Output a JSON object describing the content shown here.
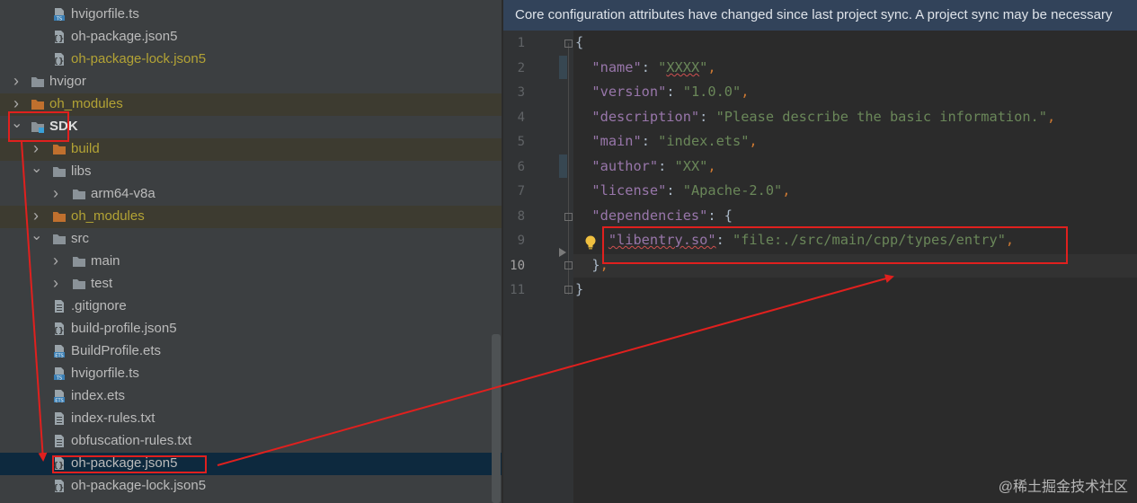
{
  "project_tree": {
    "rows": [
      {
        "label": "hvigorfile.ts",
        "icon": "ts-file-icon",
        "indent": 1,
        "arrow": "",
        "style": ""
      },
      {
        "label": "oh-package.json5",
        "icon": "json5-file-icon",
        "indent": 1,
        "arrow": "",
        "style": ""
      },
      {
        "label": "oh-package-lock.json5",
        "icon": "json5-file-icon",
        "indent": 1,
        "arrow": "",
        "style": "modified"
      },
      {
        "label": "hvigor",
        "icon": "folder-icon",
        "indent": 0,
        "arrow": "right",
        "style": ""
      },
      {
        "label": "oh_modules",
        "icon": "folder-excluded-icon",
        "indent": 0,
        "arrow": "right",
        "style": "excluded"
      },
      {
        "label": "SDK",
        "icon": "module-folder-icon",
        "indent": 0,
        "arrow": "down",
        "style": "bold"
      },
      {
        "label": "build",
        "icon": "folder-excluded-icon",
        "indent": 1,
        "arrow": "right",
        "style": "excluded"
      },
      {
        "label": "libs",
        "icon": "folder-icon",
        "indent": 1,
        "arrow": "down",
        "style": ""
      },
      {
        "label": "arm64-v8a",
        "icon": "folder-icon",
        "indent": 2,
        "arrow": "right",
        "style": ""
      },
      {
        "label": "oh_modules",
        "icon": "folder-excluded-icon",
        "indent": 1,
        "arrow": "right",
        "style": "excluded"
      },
      {
        "label": "src",
        "icon": "folder-icon",
        "indent": 1,
        "arrow": "down",
        "style": ""
      },
      {
        "label": "main",
        "icon": "folder-icon",
        "indent": 2,
        "arrow": "right",
        "style": ""
      },
      {
        "label": "test",
        "icon": "folder-icon",
        "indent": 2,
        "arrow": "right",
        "style": ""
      },
      {
        "label": ".gitignore",
        "icon": "text-file-icon",
        "indent": 1,
        "arrow": "",
        "style": ""
      },
      {
        "label": "build-profile.json5",
        "icon": "json5-file-icon",
        "indent": 1,
        "arrow": "",
        "style": ""
      },
      {
        "label": "BuildProfile.ets",
        "icon": "ets-file-icon",
        "indent": 1,
        "arrow": "",
        "style": ""
      },
      {
        "label": "hvigorfile.ts",
        "icon": "ts-file-icon",
        "indent": 1,
        "arrow": "",
        "style": ""
      },
      {
        "label": "index.ets",
        "icon": "ets-file-icon",
        "indent": 1,
        "arrow": "",
        "style": ""
      },
      {
        "label": "index-rules.txt",
        "icon": "text-file-icon",
        "indent": 1,
        "arrow": "",
        "style": ""
      },
      {
        "label": "obfuscation-rules.txt",
        "icon": "text-file-icon",
        "indent": 1,
        "arrow": "",
        "style": ""
      },
      {
        "label": "oh-package.json5",
        "icon": "json5-file-icon",
        "indent": 1,
        "arrow": "",
        "style": "selected"
      },
      {
        "label": "oh-package-lock.json5",
        "icon": "json5-file-icon",
        "indent": 1,
        "arrow": "",
        "style": ""
      }
    ]
  },
  "editor": {
    "banner": "Core configuration attributes have changed since last project sync. A project sync may be necessary",
    "line_numbers": [
      "1",
      "2",
      "3",
      "4",
      "5",
      "6",
      "7",
      "8",
      "9",
      "10",
      "11"
    ],
    "current_line": "10",
    "lines": {
      "l1": {
        "brace": "{"
      },
      "l2": {
        "key": "\"name\"",
        "colon": ": ",
        "q1": "\"",
        "val": "XXXX",
        "q2": "\"",
        "comma": ","
      },
      "l3": {
        "key": "\"version\"",
        "colon": ": ",
        "val": "\"1.0.0\"",
        "comma": ","
      },
      "l4": {
        "key": "\"description\"",
        "colon": ": ",
        "val": "\"Please describe the basic information.\"",
        "comma": ","
      },
      "l5": {
        "key": "\"main\"",
        "colon": ": ",
        "val": "\"index.ets\"",
        "comma": ","
      },
      "l6": {
        "key": "\"author\"",
        "colon": ": ",
        "val": "\"XX\"",
        "comma": ","
      },
      "l7": {
        "key": "\"license\"",
        "colon": ": ",
        "val": "\"Apache-2.0\"",
        "comma": ","
      },
      "l8": {
        "key": "\"dependencies\"",
        "colon": ": ",
        "brace": "{"
      },
      "l9": {
        "key": "\"libentry.so\"",
        "colon": ": ",
        "val": "\"file:./src/main/cpp/types/entry\"",
        "comma": ","
      },
      "l10": {
        "brace": "}",
        "comma": ","
      },
      "l11": {
        "brace": "}"
      }
    }
  },
  "watermark": "@稀土掘金技术社区",
  "colors": {
    "annotation_red": "#e0201e",
    "banner": "#32435a",
    "selection": "#0d293e"
  }
}
